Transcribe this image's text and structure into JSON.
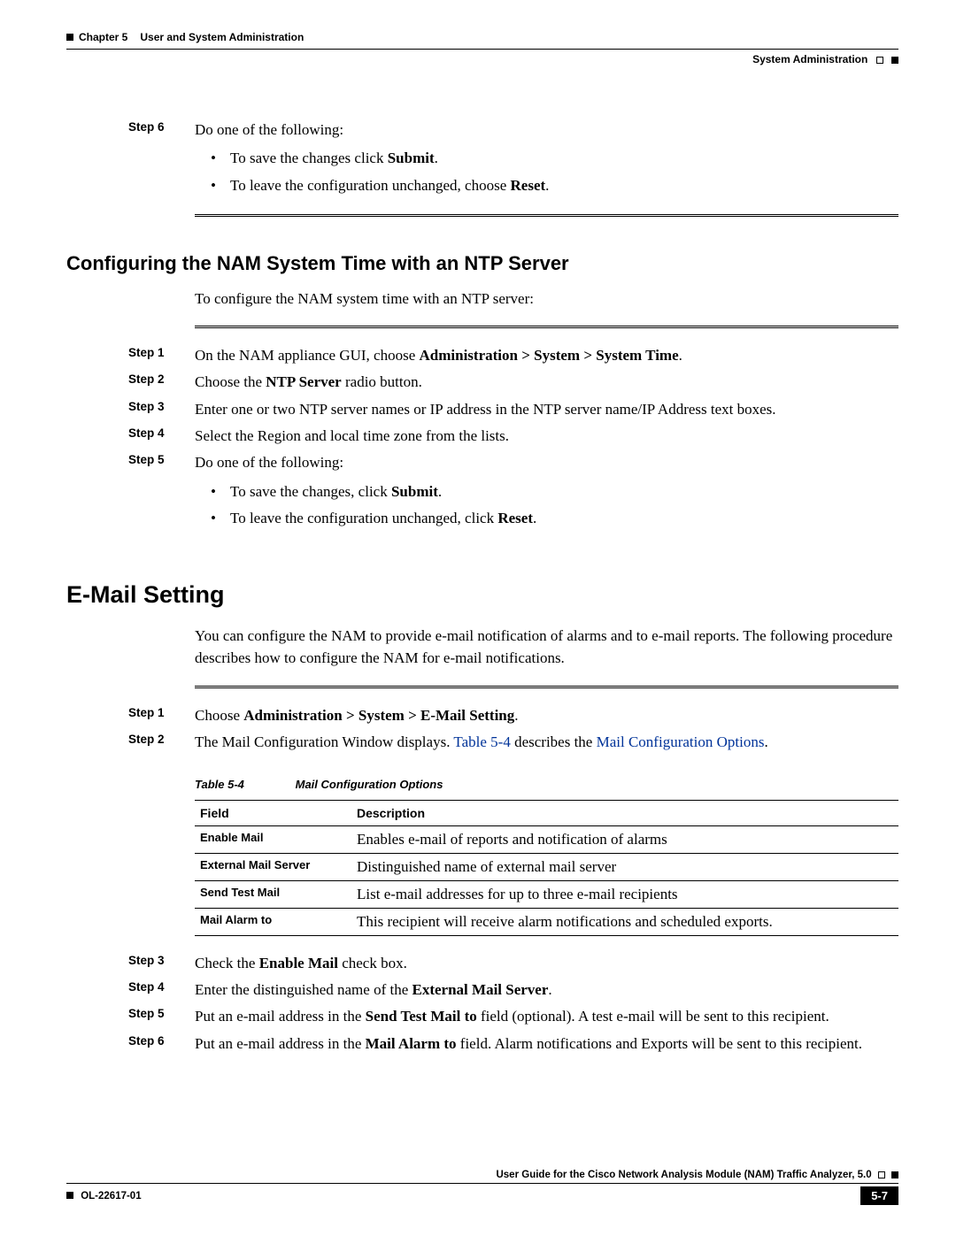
{
  "header": {
    "chapter": "Chapter 5",
    "chapter_title": "User and System Administration",
    "section": "System Administration"
  },
  "block1": {
    "step6_label": "Step 6",
    "step6_text": "Do one of the following:",
    "bullet1_pre": "To save the changes click ",
    "bullet1_bold": "Submit",
    "bullet1_post": ".",
    "bullet2_pre": "To leave the configuration unchanged, choose ",
    "bullet2_bold": "Reset",
    "bullet2_post": "."
  },
  "ntp": {
    "heading": "Configuring the NAM System Time with an NTP Server",
    "intro": "To configure the NAM system time with an NTP server:",
    "s1_label": "Step 1",
    "s1_pre": "On the NAM appliance GUI, choose ",
    "s1_bold": "Administration > System > System Time",
    "s1_post": ".",
    "s2_label": "Step 2",
    "s2_pre": "Choose the ",
    "s2_bold": "NTP Server",
    "s2_post": " radio button.",
    "s3_label": "Step 3",
    "s3_text": "Enter one or two NTP server names or IP address in the NTP server name/IP Address text boxes.",
    "s4_label": "Step 4",
    "s4_text": "Select the Region and local time zone from the lists.",
    "s5_label": "Step 5",
    "s5_text": "Do one of the following:",
    "b1_pre": "To save the changes, click ",
    "b1_bold": "Submit",
    "b1_post": ".",
    "b2_pre": "To leave the configuration unchanged, click ",
    "b2_bold": "Reset",
    "b2_post": "."
  },
  "email": {
    "heading": "E-Mail Setting",
    "intro": "You can configure the NAM to provide e-mail notification of alarms and to e-mail reports. The following procedure describes how to configure the NAM for e-mail notifications.",
    "s1_label": "Step 1",
    "s1_pre": "Choose ",
    "s1_bold": "Administration > System > E-Mail Setting",
    "s1_post": ".",
    "s2_label": "Step 2",
    "s2_pre": "The Mail Configuration Window displays. ",
    "s2_link1": "Table 5-4",
    "s2_mid": " describes the ",
    "s2_link2": "Mail Configuration Options",
    "s2_post": ".",
    "table_caption_label": "Table 5-4",
    "table_caption_title": "Mail Configuration Options",
    "th_field": "Field",
    "th_desc": "Description",
    "r1f": "Enable Mail",
    "r1d": "Enables e-mail of reports and notification of alarms",
    "r2f": "External Mail Server",
    "r2d": "Distinguished name of external mail server",
    "r3f": "Send Test Mail",
    "r3d": "List e-mail addresses for up to three e-mail recipients",
    "r4f": "Mail Alarm to",
    "r4d": "This recipient will receive alarm notifications and scheduled exports.",
    "s3_label": "Step 3",
    "s3_pre": "Check the ",
    "s3_bold": "Enable Mail",
    "s3_post": " check box.",
    "s4_label": "Step 4",
    "s4_pre": "Enter the distinguished name of the ",
    "s4_bold": "External Mail Server",
    "s4_post": ".",
    "s5_label": "Step 5",
    "s5_pre": "Put an e-mail address in the ",
    "s5_bold": "Send Test Mail to",
    "s5_post": " field (optional). A test e-mail will be sent to this recipient.",
    "s6_label": "Step 6",
    "s6_pre": "Put an e-mail address in the ",
    "s6_bold": "Mail Alarm to",
    "s6_post": " field. Alarm notifications and Exports will be sent to this recipient."
  },
  "footer": {
    "guide": "User Guide for the Cisco Network Analysis Module (NAM) Traffic Analyzer, 5.0",
    "docid": "OL-22617-01",
    "page": "5-7"
  }
}
